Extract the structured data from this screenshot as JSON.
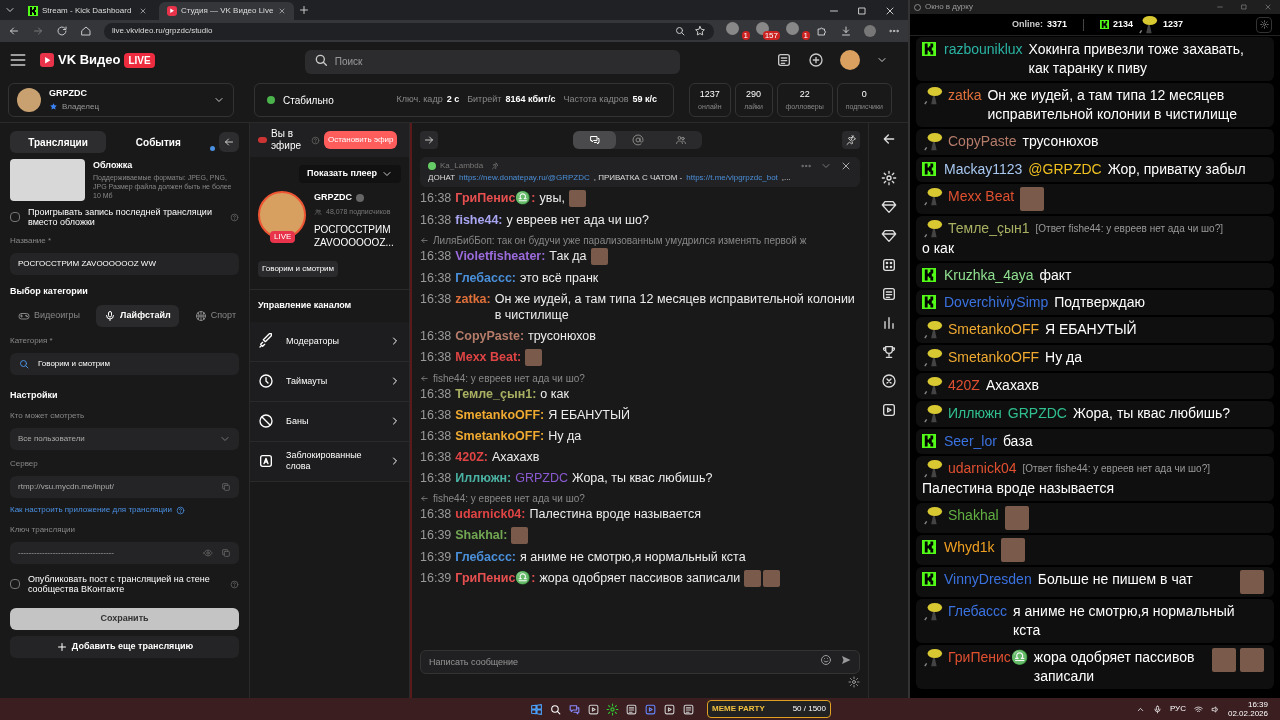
{
  "browser": {
    "tabs": [
      {
        "title": "Stream - Kick Dashboard",
        "kind": "kick",
        "selected": false
      },
      {
        "title": "Студия — VK Видео Live",
        "kind": "vk",
        "selected": true
      }
    ],
    "url": "live.vkvideo.ru/grpzdc/studio",
    "extension_badges": [
      "1",
      "157",
      "1"
    ]
  },
  "header": {
    "logo": "VK Видео",
    "live_badge": "LIVE",
    "search_placeholder": "Поиск"
  },
  "channel": {
    "name": "GRPZDC",
    "role": "Владелец"
  },
  "status": {
    "state": "Стабильно",
    "metrics": [
      {
        "label": "Ключ. кадр",
        "value": "2 с"
      },
      {
        "label": "Битрейт",
        "value": "8164 кбит/с"
      },
      {
        "label": "Частота кадров",
        "value": "59 к/с"
      }
    ]
  },
  "counters": [
    {
      "value": "1237",
      "label": "онлайн"
    },
    {
      "value": "290",
      "label": "лайки"
    },
    {
      "value": "22",
      "label": "фолловеры"
    },
    {
      "value": "0",
      "label": "подписчики"
    }
  ],
  "left_panel": {
    "tabs": [
      {
        "label": "Трансляции",
        "selected": true,
        "dot": false
      },
      {
        "label": "События",
        "selected": false,
        "dot": true
      }
    ],
    "cover": {
      "title": "Обложка",
      "hint": "Поддерживаемые форматы: JPEG, PNG, JPG Размер файла должен быть не более 10 Мб"
    },
    "replay_checkbox": {
      "label": "Проигрывать запись последней трансляции вместо обложки",
      "checked": false
    },
    "name_label": "Название *",
    "name_value": "РОСГОССТРИМ ZAVOOOOOOZ WW",
    "category_heading": "Выбор категории",
    "category_tabs": [
      {
        "label": "Видеоигры",
        "kind": "gamepad",
        "selected": false
      },
      {
        "label": "Лайфстайл",
        "kind": "mic",
        "selected": true
      },
      {
        "label": "Спорт",
        "kind": "ball",
        "selected": false
      }
    ],
    "category_label": "Категория *",
    "category_value": "Говорим и смотрим",
    "settings_heading": "Настройки",
    "who_label": "Кто может смотреть",
    "who_value": "Все пользователи",
    "server_label": "Сервер",
    "server_value": "rtmp://vsu.mycdn.me/input/",
    "help_link": "Как настроить приложение для трансляции",
    "key_label": "Ключ трансляции",
    "key_value": "------------------------------------",
    "publish_checkbox": {
      "label": "Опубликовать пост с трансляцией на стене сообщества ВКонтакте",
      "checked": false
    },
    "save_button": "Сохранить",
    "add_button": "Добавить еще трансляцию"
  },
  "middle_panel": {
    "live_label": "Вы в эфире",
    "stop_button": "Остановить эфир",
    "show_player": "Показать плеер",
    "channel_name": "GRPZDC",
    "subscribers": "48,078 подписчиков",
    "stream_title": "РОСГОССТРИМ ZAVOOOOOOZ...",
    "live_badge": "LIVE",
    "category_tag": "Говорим и смотрим",
    "manage_heading": "Управление каналом",
    "menu": [
      {
        "label": "Модераторы",
        "kind": "sword"
      },
      {
        "label": "Таймауты",
        "kind": "clock"
      },
      {
        "label": "Баны",
        "kind": "ban"
      },
      {
        "label": "Заблокированные слова",
        "kind": "letter"
      }
    ]
  },
  "chat": {
    "tabs": [
      {
        "kind": "chat",
        "selected": true
      },
      {
        "kind": "at",
        "selected": false
      },
      {
        "kind": "users",
        "selected": false
      }
    ],
    "pinned": {
      "author": "Ka_Lambda",
      "parts": [
        {
          "kind": "text",
          "text": "ДОНАТ"
        },
        {
          "kind": "link",
          "text": "https://new.donatepay.ru/@GRPZDC"
        },
        {
          "kind": "text",
          "text": ", ПРИВАТКА С ЧАТОМ -"
        },
        {
          "kind": "link",
          "text": "https://t.me/vipgrpzdc_bot"
        },
        {
          "kind": "text",
          "text": ",..."
        }
      ]
    },
    "messages": [
      {
        "time": "16:38",
        "author": "ГриПенис♎:",
        "color": "#e85050",
        "text": "увы,",
        "emotes": [
          {
            "kind": "emote"
          }
        ]
      },
      {
        "time": "16:38",
        "author": "fishe44:",
        "color": "#a9a6f2",
        "text": "у евреев нет ада чи шо?"
      },
      {
        "reply": "ЛиляБибБоп: так он будучи уже парализованным умудрился изменять первой ж",
        "time": "16:38",
        "author": "Violetfisheater:",
        "color": "#9b6bdb",
        "text": "Так да",
        "emotes": [
          {
            "kind": "emote"
          }
        ]
      },
      {
        "time": "16:38",
        "author": "Глебассс:",
        "color": "#4a8fd9",
        "text": "это всё пранк"
      },
      {
        "time": "16:38",
        "author": "zatka:",
        "color": "#e0703a",
        "text": "Он же иудей, а там типа 12 месяцев исправительной колонии в чистилище"
      },
      {
        "time": "16:38",
        "author": "CopyPaste:",
        "color": "#b57c6a",
        "text": "трусонюхов"
      },
      {
        "time": "16:38",
        "author": "Mexx Beat:",
        "color": "#e04444",
        "emotes": [
          {
            "kind": "emote"
          }
        ]
      },
      {
        "reply": "fishe44: у евреев нет ада чи шо?",
        "time": "16:38",
        "author": "Темле_çын1:",
        "color": "#a9b062",
        "text": "о как"
      },
      {
        "time": "16:38",
        "author": "SmetankoOFF:",
        "color": "#f0aa30",
        "text": "Я ЕБАНУТЫЙ"
      },
      {
        "time": "16:38",
        "author": "SmetankoOFF:",
        "color": "#f0aa30",
        "text": "Ну да"
      },
      {
        "time": "16:38",
        "author": "420Z:",
        "color": "#e04444",
        "text": "Ахахахв"
      },
      {
        "time": "16:38",
        "author": "Иллюжн:",
        "color": "#4ab3a3",
        "mention": {
          "text": "GRPZDC",
          "color": "#8a5ad0"
        },
        "text": "Жора, ты квас любишь?"
      },
      {
        "reply": "fishe44: у евреев нет ада чи шо?",
        "time": "16:38",
        "author": "udarnick04:",
        "color": "#e04444",
        "text": "Палестина вроде называется"
      },
      {
        "time": "16:39",
        "author": "Shakhal:",
        "color": "#72a652",
        "emotes": [
          {
            "kind": "emote"
          }
        ]
      },
      {
        "time": "16:39",
        "author": "Глебассс:",
        "color": "#4a8fd9",
        "text": "я аниме не смотрю,я нормальный кста"
      },
      {
        "time": "16:39",
        "author": "ГриПенис♎:",
        "color": "#e85050",
        "text": "жора одобряет пассивов записали",
        "emotes": [
          {
            "kind": "emote"
          },
          {
            "kind": "emote"
          }
        ]
      }
    ],
    "input_placeholder": "Написать сообщение"
  },
  "overlay_window": {
    "title": "Окно в дурку",
    "online_label": "Online:",
    "online_value": "3371",
    "kick_count": "2134",
    "vk_count": "1237",
    "messages": [
      {
        "kind": "kick",
        "author": "razbouniklux",
        "color": "#2ab3a3",
        "text": "Хокинга привезли тоже захавать, как таранку к пиву"
      },
      {
        "kind": "vk",
        "author": "zatka",
        "color": "#e0703a",
        "text": "Он же иудей, а там типа 12 месяцев исправительной колонии в чистилище"
      },
      {
        "kind": "vk",
        "author": "CopyPaste",
        "color": "#b57c6a",
        "text": "трусонюхов"
      },
      {
        "kind": "kick",
        "author": "Mackay1123",
        "color": "#a8c8f0",
        "mention": {
          "text": "@GRPZDC",
          "color": "#f0c020"
        },
        "text": "Жор, приватку забыл"
      },
      {
        "kind": "vk",
        "author": "Mexx Beat",
        "color": "#e05030",
        "emotes": [
          {
            "kind": "emote"
          }
        ]
      },
      {
        "kind": "vk",
        "author": "Темле_çын1",
        "color": "#a9b062",
        "reply": "[Ответ fishe44: у евреев нет ада чи шо?]",
        "text": "о как"
      },
      {
        "kind": "kick",
        "author": "Kruzhka_4aya",
        "color": "#90e090",
        "text": "факт"
      },
      {
        "kind": "kick",
        "author": "DoverchiviySimp",
        "color": "#3a72e0",
        "text": "Подтверждаю"
      },
      {
        "kind": "vk",
        "author": "SmetankoOFF",
        "color": "#f0aa30",
        "text": "Я ЕБАНУТЫЙ"
      },
      {
        "kind": "vk",
        "author": "SmetankoOFF",
        "color": "#f0aa30",
        "text": "Ну да"
      },
      {
        "kind": "vk",
        "author": "420Z",
        "color": "#e05030",
        "text": "Ахахахв"
      },
      {
        "kind": "vk",
        "author": "Иллюжн",
        "color": "#30c090",
        "mention": {
          "text": "GRPZDC",
          "color": "#30c090"
        },
        "text": "Жора, ты квас любишь?"
      },
      {
        "kind": "kick",
        "author": "Seer_lor",
        "color": "#3a72e0",
        "text": "база"
      },
      {
        "kind": "vk",
        "author": "udarnick04",
        "color": "#e05030",
        "reply": "[Ответ fishe44: у евреев нет ада чи шо?]",
        "text": "Палестина вроде называется"
      },
      {
        "kind": "vk",
        "author": "Shakhal",
        "color": "#62b042",
        "emotes": [
          {
            "kind": "emote"
          }
        ]
      },
      {
        "kind": "kick",
        "author": "Whyd1k",
        "color": "#f0a020",
        "emotes": [
          {
            "kind": "emote"
          }
        ]
      },
      {
        "kind": "kick",
        "author": "VinnyDresden",
        "color": "#3a72e0",
        "text": "Больше не пишем в чат",
        "emotes": [
          {
            "kind": "emote"
          }
        ]
      },
      {
        "kind": "vk",
        "author": "Глебассс",
        "color": "#3a72e0",
        "text": "я аниме не смотрю,я нормальный кста"
      },
      {
        "kind": "vk",
        "author": "ГриПенис♎",
        "color": "#e05030",
        "text": "жора одобряет пассивов записали",
        "emotes": [
          {
            "kind": "emote"
          },
          {
            "kind": "emote"
          }
        ]
      }
    ]
  },
  "taskbar": {
    "widget_title": "MEME PARTY",
    "widget_value": "50 / 1500",
    "language": "РУС",
    "time": "16:39",
    "date": "02.02.2026"
  }
}
